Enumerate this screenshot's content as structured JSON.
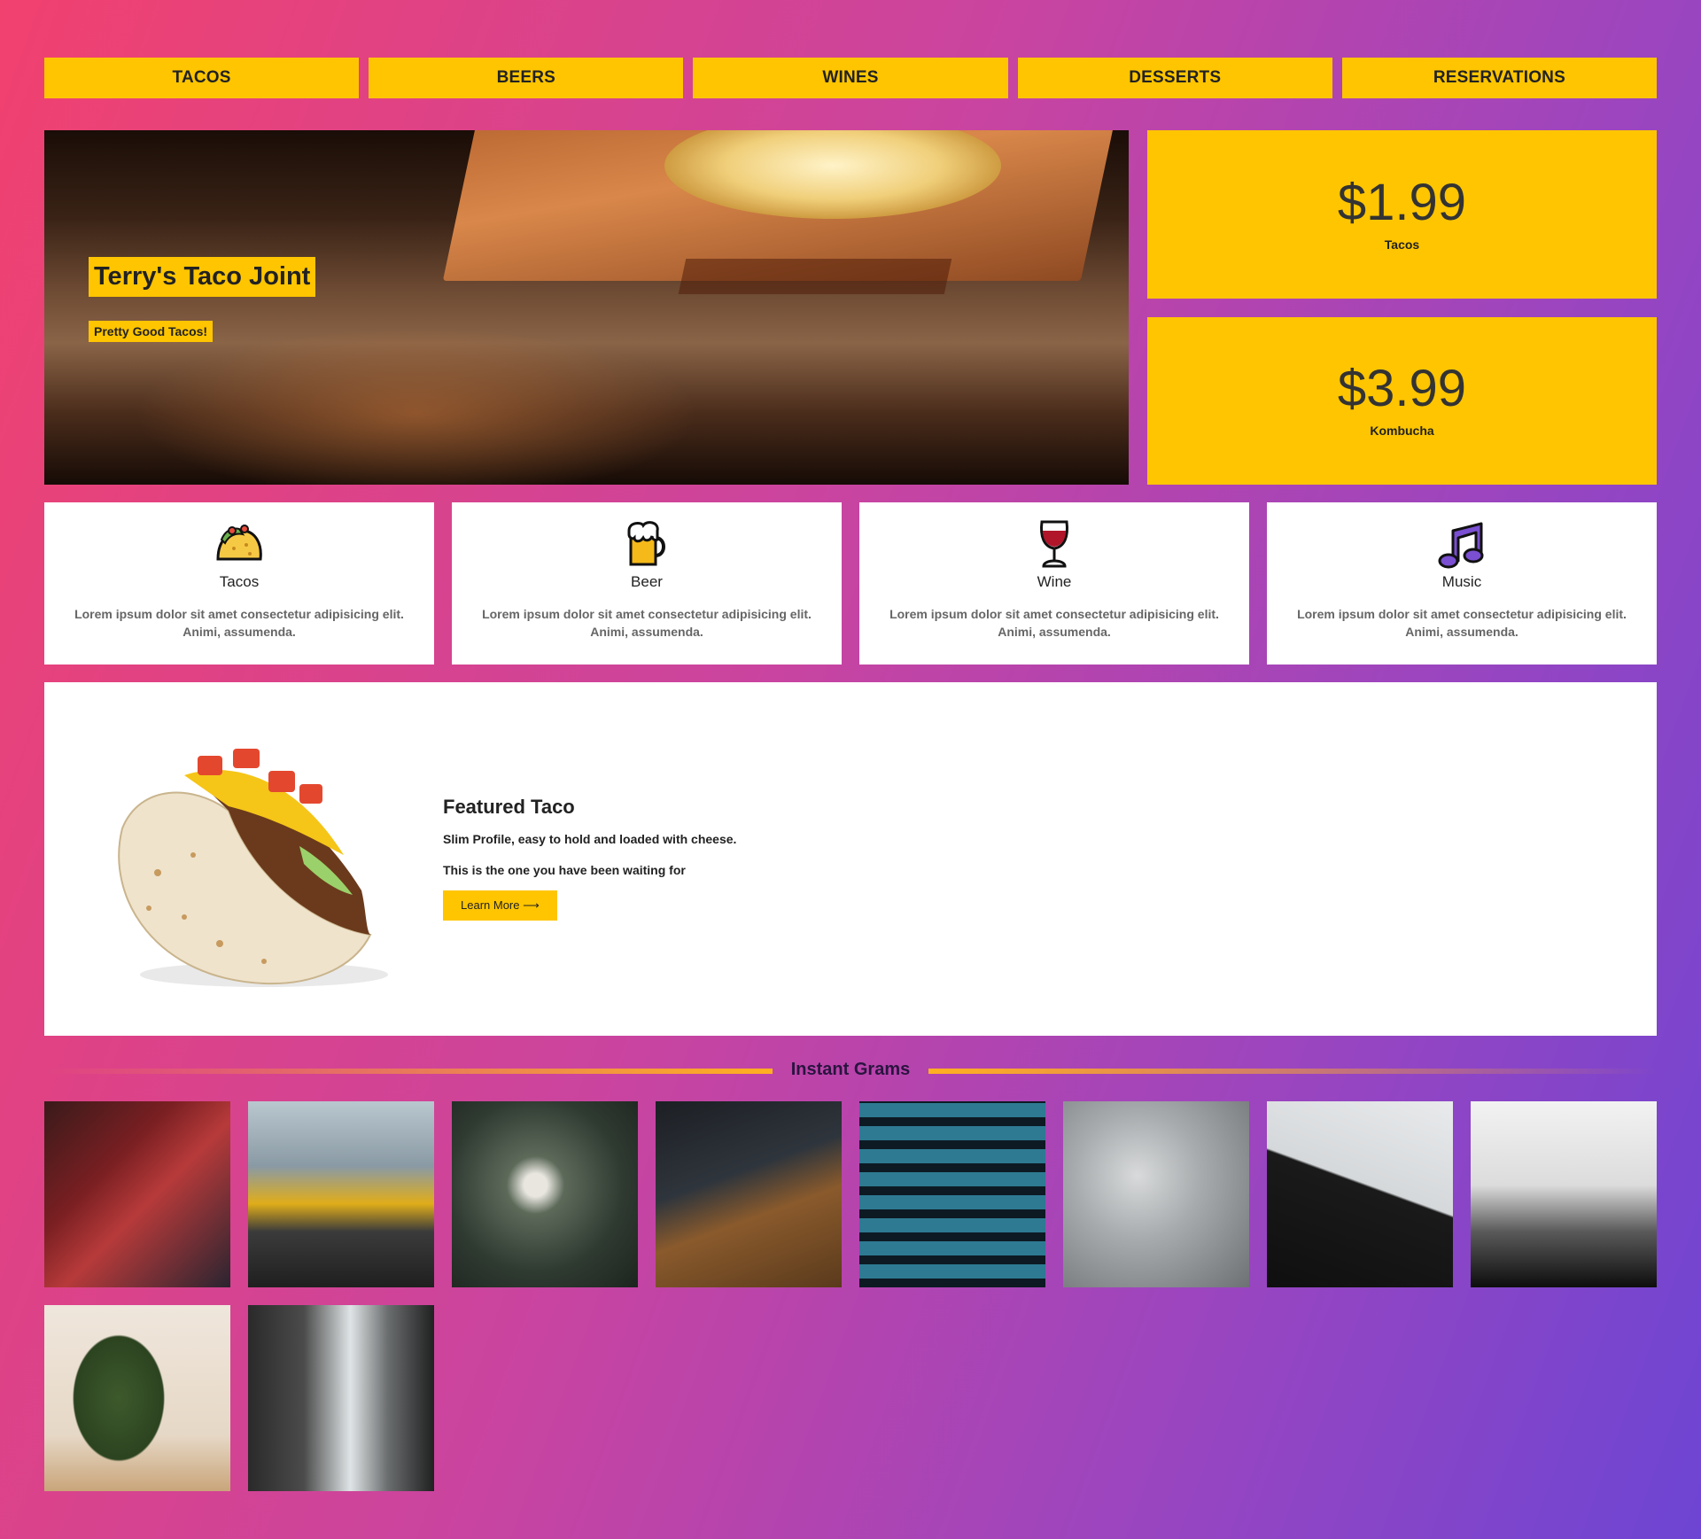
{
  "nav": [
    "TACOS",
    "BEERS",
    "WINES",
    "DESSERTS",
    "RESERVATIONS"
  ],
  "hero": {
    "title": "Terry's Taco Joint",
    "subtitle": "Pretty Good Tacos!"
  },
  "prices": [
    {
      "amount": "$1.99",
      "label": "Tacos"
    },
    {
      "amount": "$3.99",
      "label": "Kombucha"
    }
  ],
  "features": [
    {
      "icon": "taco-icon",
      "name": "Tacos",
      "desc": "Lorem ipsum dolor sit amet consectetur adipisicing elit. Animi, assumenda."
    },
    {
      "icon": "beer-mug-icon",
      "name": "Beer",
      "desc": "Lorem ipsum dolor sit amet consectetur adipisicing elit. Animi, assumenda."
    },
    {
      "icon": "wine-glass-icon",
      "name": "Wine",
      "desc": "Lorem ipsum dolor sit amet consectetur adipisicing elit. Animi, assumenda."
    },
    {
      "icon": "music-note-icon",
      "name": "Music",
      "desc": "Lorem ipsum dolor sit amet consectetur adipisicing elit. Animi, assumenda."
    }
  ],
  "featured": {
    "title": "Featured Taco",
    "line1": "Slim Profile, easy to hold and loaded with cheese.",
    "line2": "This is the one you have been waiting for",
    "button": "Learn More ⟶"
  },
  "grams": {
    "title": "Instant Grams",
    "photos": [
      {
        "name": "photo-red-palace",
        "bg": "linear-gradient(135deg,#3a1a1a 0%,#7a1f22 35%,#b73a3a 55%,#2a2430 100%)"
      },
      {
        "name": "photo-yellow-car",
        "bg": "linear-gradient(180deg,#b9c7cf 0%,#8a9aa4 35%,#e0ad1a 55%,#3b3b3b 70%,#1f1f1f 100%)"
      },
      {
        "name": "photo-white-blossom",
        "bg": "radial-gradient(circle at 45% 45%,#e8e6df 0 8%,#5d6a5a 20%,#2f3a31 60%,#1d241f 100%)"
      },
      {
        "name": "photo-desk-setup",
        "bg": "linear-gradient(160deg,#1c1f24 0%,#2f353c 40%,#8a5a2c 60%,#5a3a1c 100%)"
      },
      {
        "name": "photo-tiled-hall",
        "bg": "repeating-linear-gradient(0deg,#0d1a24 0 10px,#2e7a93 10px 26px),repeating-linear-gradient(90deg,#0d1a24 0 8px,#5fb8cf 8px 24px)"
      },
      {
        "name": "photo-frosted-branches",
        "bg": "radial-gradient(circle at 40% 40%,#d8dadb 0%,#a7abad 40%,#6d7173 100%)"
      },
      {
        "name": "photo-coffee-cup",
        "bg": "linear-gradient(200deg,#e8eaec 0%,#d5d8da 45%,#1a1a1a 46%,#0f0f0f 100%)"
      },
      {
        "name": "photo-foggy-forest",
        "bg": "linear-gradient(180deg,#f2f2f2 0%,#dcdcdc 45%,#5a5a5a 70%,#0d0d0d 100%)"
      },
      {
        "name": "photo-christmas-tree",
        "bg": "radial-gradient(ellipse 40% 55% at 40% 50%,#3d5a2c 0%,#2c4320 60%,transparent 62%),linear-gradient(180deg,#efe6dc 0%,#e6d8c6 70%,#c9a57a 100%)"
      },
      {
        "name": "photo-kitchen",
        "bg": "linear-gradient(90deg,#2a2a2a 0%,#4b4b4b 30%,#dfe4e6 55%,#6b6e6f 75%,#202020 100%)"
      }
    ]
  },
  "colors": {
    "accent": "#ffc500",
    "card": "#ffffff"
  }
}
